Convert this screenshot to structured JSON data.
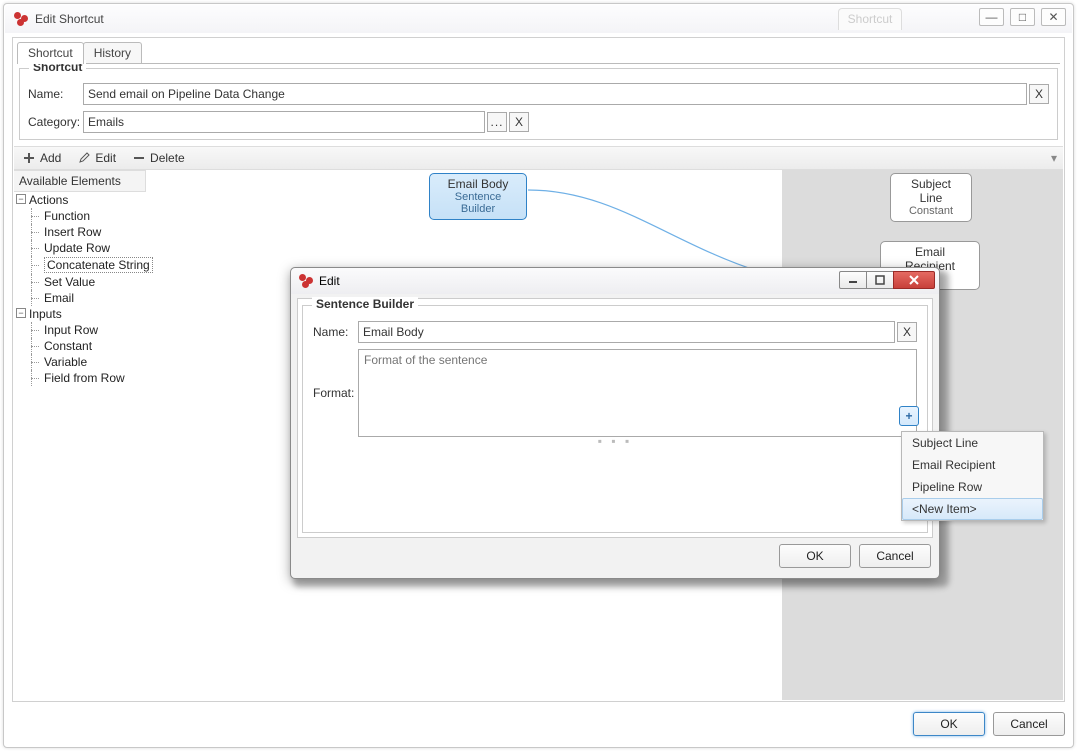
{
  "mainWindow": {
    "title": "Edit Shortcut",
    "ghostTab": "Shortcut",
    "winbtn": {
      "min": "—",
      "max": "□",
      "close": "✕"
    }
  },
  "tabs": {
    "shortcut": "Shortcut",
    "history": "History"
  },
  "shortcutGroup": {
    "legend": "Shortcut",
    "nameLabel": "Name:",
    "nameValue": "Send email on Pipeline Data Change",
    "categoryLabel": "Category:",
    "categoryValue": "Emails",
    "browse": "...",
    "clear": "X"
  },
  "toolbar": {
    "add": "Add",
    "edit": "Edit",
    "delete": "Delete"
  },
  "sidebar": {
    "header": "Available Elements",
    "actionsLabel": "Actions",
    "actions": [
      "Function",
      "Insert Row",
      "Update Row",
      "Concatenate String",
      "Set Value",
      "Email"
    ],
    "selectedAction": "Concatenate String",
    "inputsLabel": "Inputs",
    "inputs": [
      "Input Row",
      "Constant",
      "Variable",
      "Field from Row"
    ]
  },
  "nodes": {
    "emailBody": {
      "title": "Email Body",
      "sub": "Sentence Builder"
    },
    "subjectLine": {
      "title": "Subject Line",
      "sub": "Constant"
    },
    "emailRecipient": {
      "title": "Email Recipient",
      "sub": ""
    }
  },
  "modal": {
    "title": "Edit",
    "group": "Sentence Builder",
    "nameLabel": "Name:",
    "nameValue": "Email Body",
    "clear": "X",
    "formatLabel": "Format:",
    "formatPlaceholder": "Format of the sentence",
    "plus": "+",
    "ok": "OK",
    "cancel": "Cancel"
  },
  "dropdown": {
    "items": [
      "Subject Line",
      "Email Recipient",
      "Pipeline Row",
      "<New Item>"
    ]
  },
  "footer": {
    "ok": "OK",
    "cancel": "Cancel"
  }
}
